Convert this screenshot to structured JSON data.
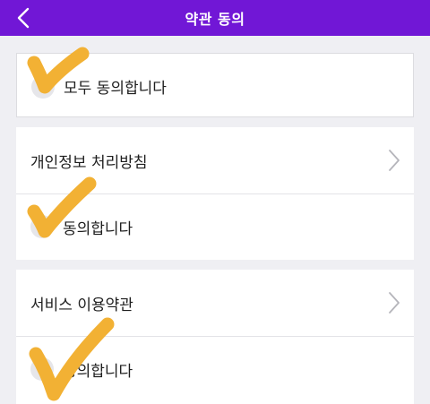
{
  "header": {
    "title": "약관 동의",
    "background": "#7117d6"
  },
  "agree_all": {
    "label": "모두 동의합니다"
  },
  "terms": [
    {
      "title": "개인정보 처리방침",
      "agree_label": "동의합니다"
    },
    {
      "title": "서비스 이용약관",
      "agree_label": "동의합니다"
    }
  ],
  "icons": {
    "back": "chevron-left-icon",
    "next": "chevron-right-icon",
    "check": "checkmark-icon"
  },
  "colors": {
    "checkmark": "#f2b134",
    "divider": "#e3e3e7",
    "background": "#efeff3"
  }
}
